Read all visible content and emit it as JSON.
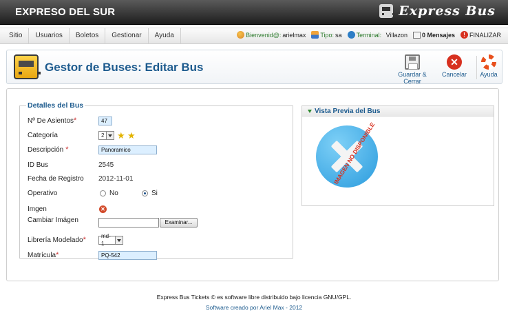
{
  "header": {
    "site_name": "EXPRESO DEL SUR",
    "logo_text": "Express Bus"
  },
  "menu": {
    "items": [
      {
        "label": "Sitio"
      },
      {
        "label": "Usuarios"
      },
      {
        "label": "Boletos"
      },
      {
        "label": "Gestionar"
      },
      {
        "label": "Ayuda"
      }
    ]
  },
  "status": {
    "welcome_label": "Bienvenid@:",
    "username": "arielmax",
    "type_label": "Tipo:",
    "type_value": "sa",
    "terminal_label": "Terminal:",
    "terminal_value": "Villazon",
    "messages": "0 Mensajes",
    "logout": "FINALIZAR"
  },
  "toolbar": {
    "title": "Gestor de Buses: Editar Bus",
    "save_label": "Guardar & Cerrar",
    "cancel_label": "Cancelar",
    "help_label": "Ayuda"
  },
  "details": {
    "legend": "Detalles del Bus",
    "seats_label": "Nº De Asientos",
    "seats_value": "47",
    "category_label": "Categoría",
    "category_value": "2",
    "category_stars": 2,
    "description_label": "Descripción",
    "description_value": "Panoramico",
    "id_label": "ID Bus",
    "id_value": "2545",
    "date_label": "Fecha de Registro",
    "date_value": "2012-11-01",
    "operative_label": "Operativo",
    "operative_no": "No",
    "operative_yes": "Si",
    "operative_selected": "Si",
    "image_label": "Imgen",
    "change_image_label": "Cambiar Imágen",
    "browse_label": "Examinar...",
    "library_label": "Librería Modelado",
    "library_value": "md-1",
    "plate_label": "Matrícula",
    "plate_value": "PQ-542"
  },
  "preview": {
    "title": "Vista Previa del Bus",
    "no_image_text": "IMAGEN NO DISPONIBLE"
  },
  "footer": {
    "line1": "Express Bus Tickets © es software libre distribuido bajo licencia GNU/GPL.",
    "line2": "Software creado por Ariel Max - 2012"
  },
  "colors": {
    "accent": "#1d5b8e",
    "header_bg": "#2b2b2b",
    "required": "#cc3333",
    "input_bg": "#dcefff"
  }
}
